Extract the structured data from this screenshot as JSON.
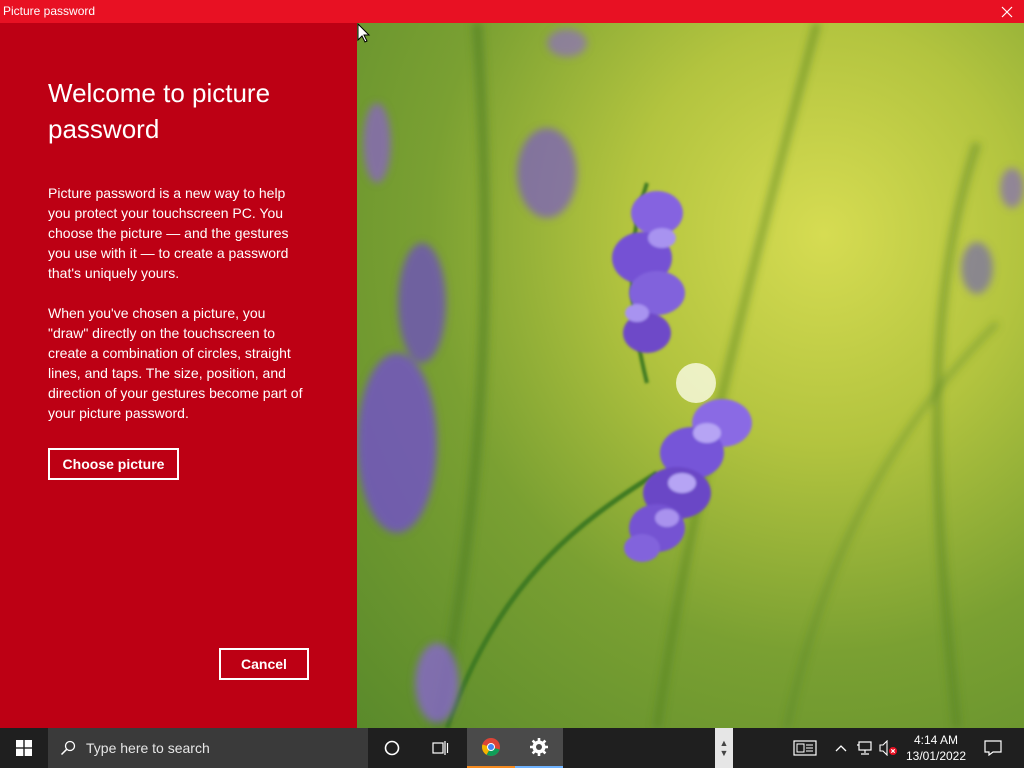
{
  "window": {
    "title": "Picture password"
  },
  "left_panel": {
    "heading": "Welcome to picture password",
    "paragraph1": "Picture password is a new way to help you protect your touchscreen PC. You choose the picture — and the gestures you use with it — to create a password that's uniquely yours.",
    "paragraph2": "When you've chosen a picture, you \"draw\" directly on the touchscreen to create a combination of circles, straight lines, and taps. The size, position, and direction of your gestures become part of your picture password.",
    "choose_label": "Choose picture",
    "cancel_label": "Cancel"
  },
  "taskbar": {
    "search_placeholder": "Type here to search",
    "time": "4:14 AM",
    "date": "13/01/2022",
    "icons": [
      "windows-icon",
      "search-icon",
      "cortana-icon",
      "task-view-icon",
      "chrome-icon",
      "settings-icon",
      "news-icon",
      "chevron-up-icon",
      "network-icon",
      "volume-muted-icon",
      "notification-icon"
    ]
  },
  "colors": {
    "title_bar": "#e81123",
    "panel": "#bd0014",
    "taskbar": "#1f1f1f"
  }
}
